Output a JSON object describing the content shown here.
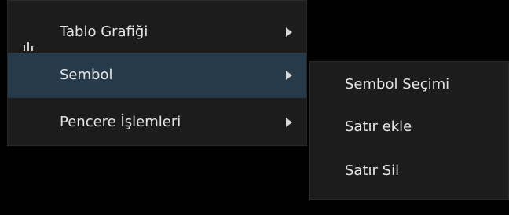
{
  "menu": {
    "items": [
      {
        "label": "Tablo Grafiği",
        "icon": "bar-chart-icon",
        "has_submenu": true,
        "active": false
      },
      {
        "label": "Sembol",
        "icon": "",
        "has_submenu": true,
        "active": true
      },
      {
        "label": "Pencere İşlemleri",
        "icon": "",
        "has_submenu": true,
        "active": false
      }
    ]
  },
  "submenu": {
    "items": [
      {
        "label": "Sembol Seçimi"
      },
      {
        "label": "Satır ekle"
      },
      {
        "label": "Satır Sil"
      }
    ]
  },
  "colors": {
    "background": "#000000",
    "menu_bg": "#1c1c1c",
    "active_bg": "#263a4a",
    "text": "#e6e6e6"
  }
}
